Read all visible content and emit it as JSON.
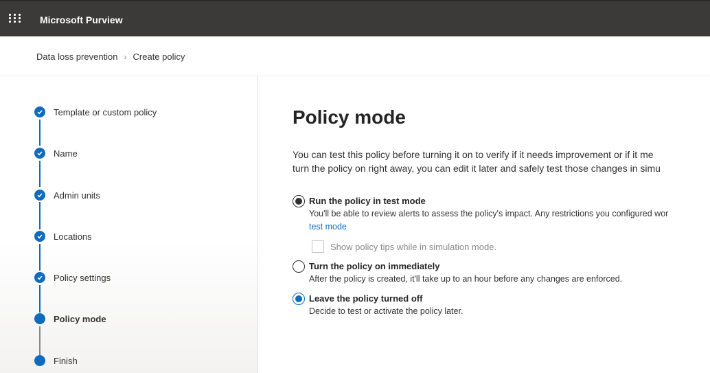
{
  "app": {
    "title": "Microsoft Purview",
    "launcher_icon": "waffle-icon"
  },
  "breadcrumb": {
    "items": [
      "Data loss prevention",
      "Create policy"
    ],
    "separator_icon": "chevron-right-icon"
  },
  "steps": [
    {
      "label": "Template or custom policy",
      "state": "completed"
    },
    {
      "label": "Name",
      "state": "completed"
    },
    {
      "label": "Admin units",
      "state": "completed"
    },
    {
      "label": "Locations",
      "state": "completed"
    },
    {
      "label": "Policy settings",
      "state": "completed"
    },
    {
      "label": "Policy mode",
      "state": "current"
    },
    {
      "label": "Finish",
      "state": "upcoming"
    }
  ],
  "main": {
    "title": "Policy mode",
    "description_line1": "You can test this policy before turning it on to verify if it needs improvement or if it me",
    "description_line2": "turn the policy on right away, you can edit it later and safely test those changes in simu",
    "options": [
      {
        "label": "Run the policy in test mode",
        "description": "You'll be able to review alerts to assess the policy's impact. Any restrictions you configured wor",
        "link": "test mode"
      },
      {
        "label": "Turn the policy on immediately",
        "description": "After the policy is created, it'll take up to an hour before any changes are enforced."
      },
      {
        "label": "Leave the policy turned off",
        "description": "Decide to test or activate the policy later.",
        "selected": true
      }
    ],
    "checkbox": {
      "label": "Show policy tips while in simulation mode.",
      "checked": false,
      "disabled": true
    }
  },
  "colors": {
    "accent": "#0f6cbd",
    "topbar": "#3b3a39"
  }
}
